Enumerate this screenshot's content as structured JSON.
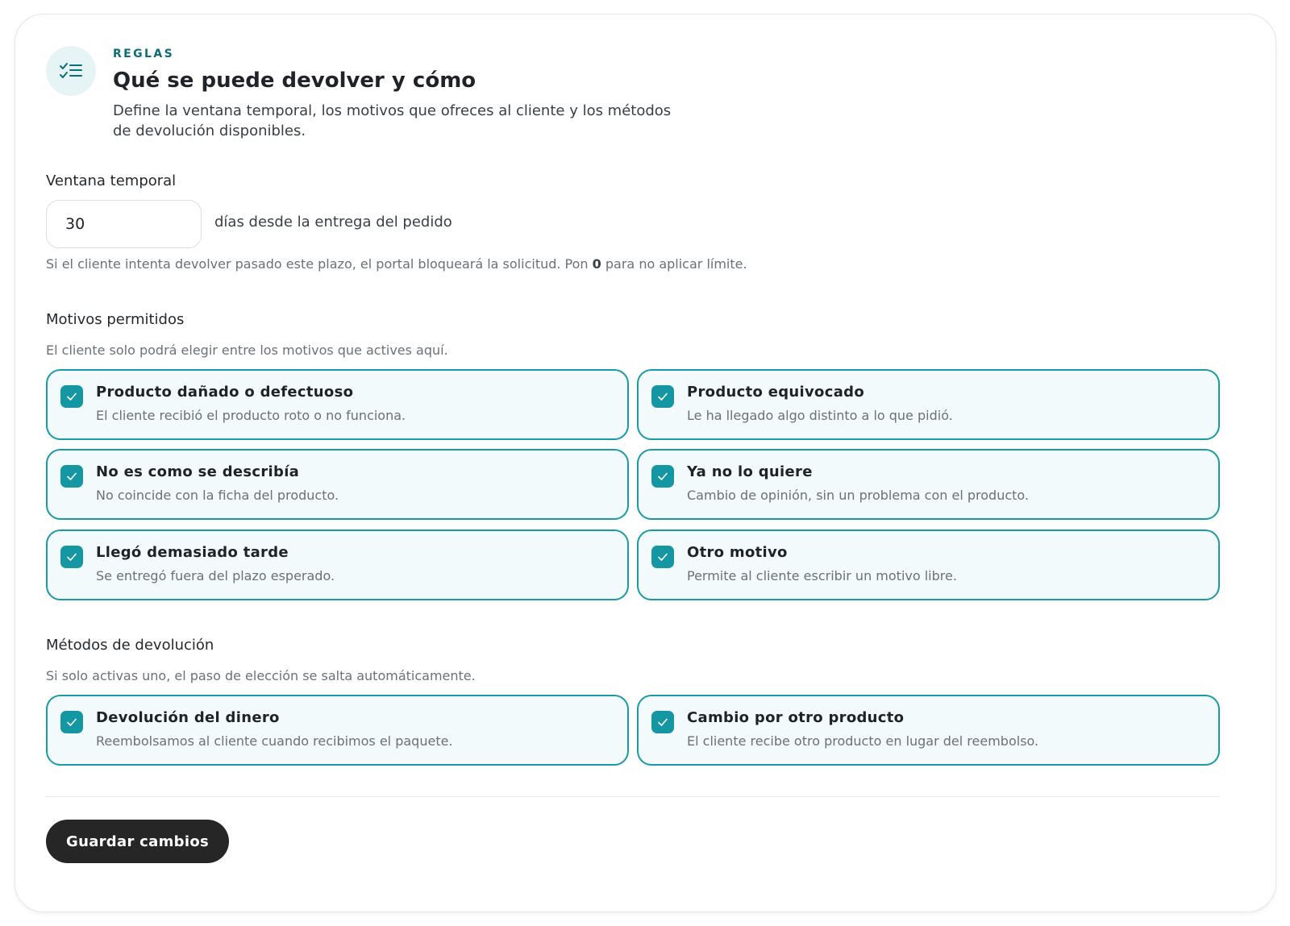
{
  "header": {
    "icon": "checklist-icon",
    "eyebrow": "REGLAS",
    "title": "Qué se puede devolver y cómo",
    "subtitle": "Define la ventana temporal, los motivos que ofreces al cliente y los métodos de devolución disponibles."
  },
  "window": {
    "label": "Ventana temporal",
    "days_value": "30",
    "suffix": "días desde la entrega del pedido",
    "help_before": "Si el cliente intenta devolver pasado este plazo, el portal bloqueará la solicitud. Pon ",
    "help_bold": "0",
    "help_after": " para no aplicar límite."
  },
  "reasons": {
    "label": "Motivos permitidos",
    "help": "El cliente solo podrá elegir entre los motivos que actives aquí.",
    "items": [
      {
        "title": "Producto dañado o defectuoso",
        "desc": "El cliente recibió el producto roto o no funciona.",
        "checked": true
      },
      {
        "title": "Producto equivocado",
        "desc": "Le ha llegado algo distinto a lo que pidió.",
        "checked": true
      },
      {
        "title": "No es como se describía",
        "desc": "No coincide con la ficha del producto.",
        "checked": true
      },
      {
        "title": "Ya no lo quiere",
        "desc": "Cambio de opinión, sin un problema con el producto.",
        "checked": true
      },
      {
        "title": "Llegó demasiado tarde",
        "desc": "Se entregó fuera del plazo esperado.",
        "checked": true
      },
      {
        "title": "Otro motivo",
        "desc": "Permite al cliente escribir un motivo libre.",
        "checked": true
      }
    ]
  },
  "methods": {
    "label": "Métodos de devolución",
    "help": "Si solo activas uno, el paso de elección se salta automáticamente.",
    "items": [
      {
        "title": "Devolución del dinero",
        "desc": "Reembolsamos al cliente cuando recibimos el paquete.",
        "checked": true
      },
      {
        "title": "Cambio por otro producto",
        "desc": "El cliente recibe otro producto en lugar del reembolso.",
        "checked": true
      }
    ]
  },
  "footer": {
    "save_label": "Guardar cambios"
  },
  "colors": {
    "accent": "#1496a3",
    "accent_border": "#1b9aa6",
    "eyebrow": "#0b6e78",
    "option_bg": "#f2fafb",
    "button_bg": "#262626"
  }
}
